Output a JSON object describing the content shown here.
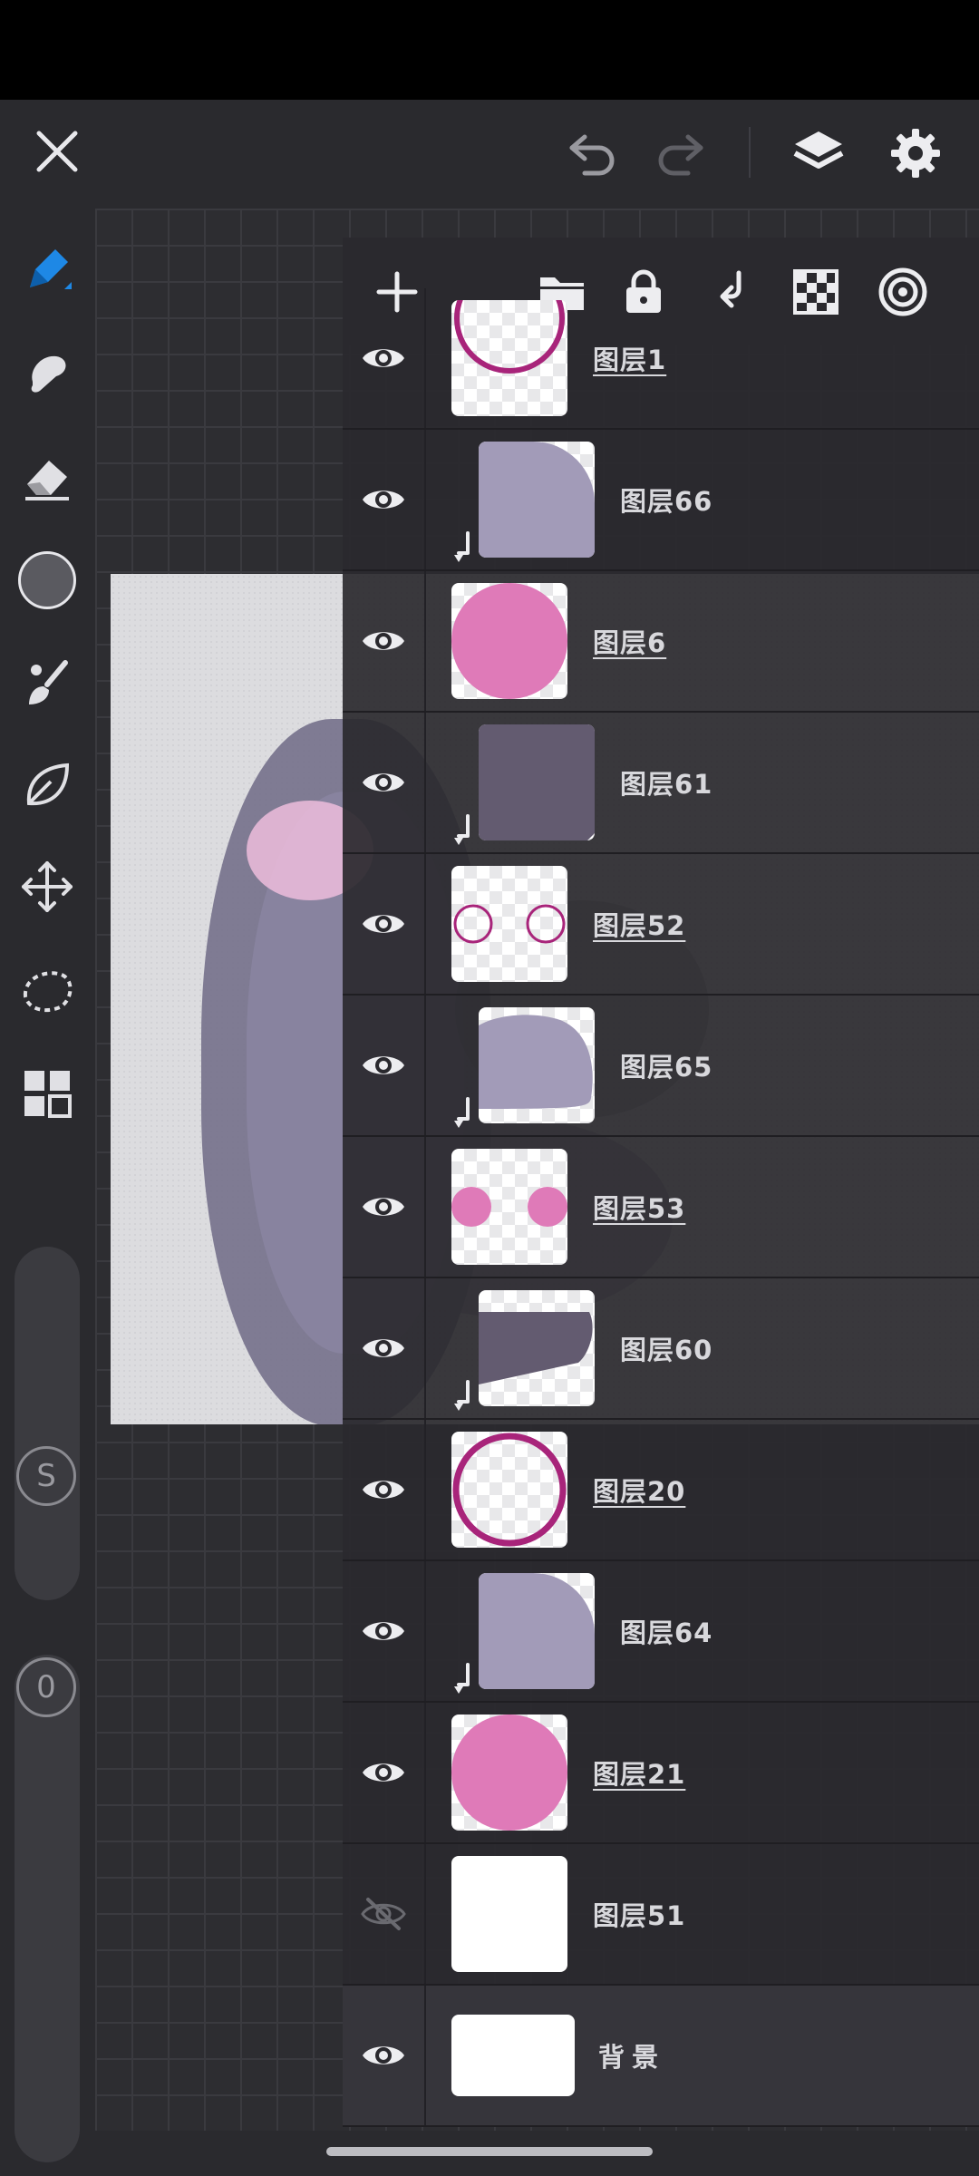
{
  "topbar": {
    "close_icon": "close-icon",
    "undo_icon": "undo-icon",
    "redo_icon": "redo-icon",
    "layers_icon": "layers-icon",
    "settings_icon": "gear-icon"
  },
  "tools": [
    "pencil-icon",
    "smudge-icon",
    "eraser-icon",
    "color-swatch",
    "brush-icon",
    "leaf-icon",
    "move-icon",
    "lasso-icon",
    "grid-icon"
  ],
  "sliders": {
    "size_label": "S",
    "opacity_label": "0"
  },
  "panel_toolbar": [
    "add-layer-icon",
    "folder-icon",
    "lock-icon",
    "merge-down-icon",
    "checker-icon",
    "target-icon"
  ],
  "layers": [
    {
      "name": "图层1",
      "underline": true,
      "clipped": false,
      "visible": true,
      "thumb": "ring-partial"
    },
    {
      "name": "图层66",
      "underline": false,
      "clipped": true,
      "visible": true,
      "thumb": "lavender-quarter"
    },
    {
      "name": "图层6",
      "underline": true,
      "clipped": false,
      "visible": true,
      "thumb": "pink-disc"
    },
    {
      "name": "图层61",
      "underline": false,
      "clipped": true,
      "visible": true,
      "thumb": "dark-square"
    },
    {
      "name": "图层52",
      "underline": true,
      "clipped": false,
      "visible": true,
      "thumb": "two-rings"
    },
    {
      "name": "图层65",
      "underline": false,
      "clipped": true,
      "visible": true,
      "thumb": "lavender-dome"
    },
    {
      "name": "图层53",
      "underline": true,
      "clipped": false,
      "visible": true,
      "thumb": "two-dots"
    },
    {
      "name": "图层60",
      "underline": false,
      "clipped": true,
      "visible": true,
      "thumb": "dark-wedge"
    },
    {
      "name": "图层20",
      "underline": true,
      "clipped": false,
      "visible": true,
      "thumb": "magenta-ring"
    },
    {
      "name": "图层64",
      "underline": false,
      "clipped": true,
      "visible": true,
      "thumb": "lavender-quarter"
    },
    {
      "name": "图层21",
      "underline": true,
      "clipped": false,
      "visible": true,
      "thumb": "pink-disc"
    },
    {
      "name": "图层51",
      "underline": false,
      "clipped": false,
      "visible": false,
      "thumb": "white"
    },
    {
      "name": "背景",
      "underline": false,
      "clipped": false,
      "visible": true,
      "thumb": "white"
    }
  ],
  "colors": {
    "accent": "#1e88e5",
    "pink": "#df7ab8",
    "magenta": "#a8247a",
    "lavender": "#a29bb8",
    "dark_purple": "#635b70",
    "current_color": "#5a5a60"
  }
}
